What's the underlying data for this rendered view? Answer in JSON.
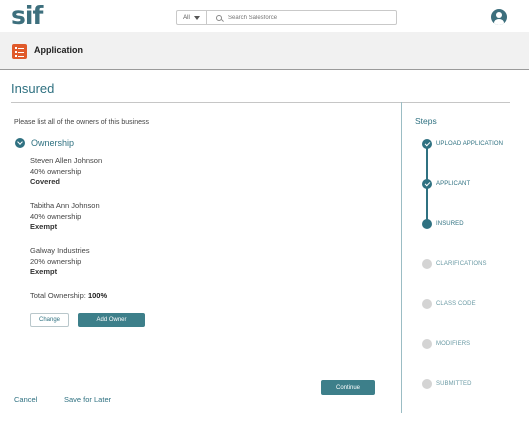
{
  "header": {
    "logo": "sif",
    "search_scope": "All",
    "search_placeholder": "Search Salesforce"
  },
  "app": {
    "title": "Application"
  },
  "page": {
    "title": "Insured"
  },
  "main": {
    "instruction": "Please list all of the owners of this business",
    "section_title": "Ownership",
    "owners": [
      {
        "name": "Steven Allen Johnson",
        "ownership": "40% ownership",
        "status": "Covered"
      },
      {
        "name": "Tabitha Ann Johnson",
        "ownership": "40% ownership",
        "status": "Exempt"
      },
      {
        "name": "Galway Industries",
        "ownership": "20% ownership",
        "status": "Exempt"
      }
    ],
    "total_label": "Total Ownership:",
    "total_value": "100%",
    "change_label": "Change",
    "add_owner_label": "Add Owner",
    "continue_label": "Continue",
    "cancel_label": "Cancel",
    "save_later_label": "Save for Later"
  },
  "steps": {
    "title": "Steps",
    "items": [
      {
        "label": "UPLOAD APPLICATION",
        "state": "done"
      },
      {
        "label": "APPLICANT",
        "state": "done"
      },
      {
        "label": "INSURED",
        "state": "current"
      },
      {
        "label": "CLARIFICATIONS",
        "state": "todo"
      },
      {
        "label": "CLASS CODE",
        "state": "todo"
      },
      {
        "label": "MODIFIERS",
        "state": "todo"
      },
      {
        "label": "SUBMITTED",
        "state": "todo"
      }
    ]
  },
  "colors": {
    "brand": "#3d6f7d",
    "accent": "#2f7181",
    "button": "#3d7f8a",
    "app_icon": "#e05a2b",
    "step_todo": "#d4d4d4"
  }
}
